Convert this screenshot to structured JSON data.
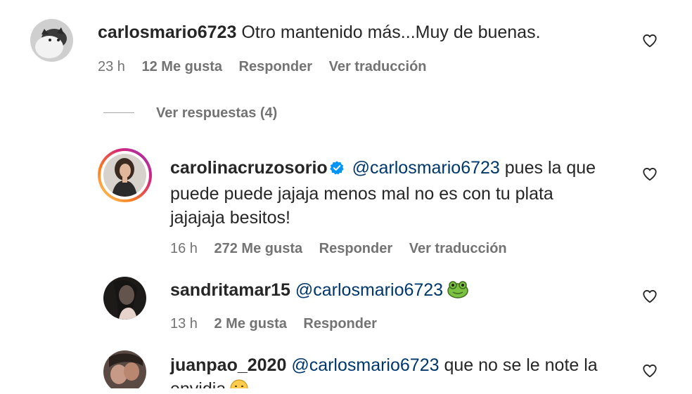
{
  "comments": [
    {
      "username": "carlosmario6723",
      "text": "Otro mantenido más...Muy de buenas.",
      "time": "23 h",
      "likes": "12 Me gusta",
      "reply": "Responder",
      "translate": "Ver traducción"
    },
    {
      "username": "carolinacruzosorio",
      "mention": "@carlosmario6723",
      "line1": "pues la que",
      "line2": "puede puede jajaja menos mal no es con tu plata",
      "line3": "jajajaja besitos!",
      "time": "16 h",
      "likes": "272 Me gusta",
      "reply": "Responder",
      "translate": "Ver traducción"
    },
    {
      "username": "sandritamar15",
      "mention": "@carlosmario6723",
      "emoji": "frog-emoji",
      "time": "13 h",
      "likes": "2 Me gusta",
      "reply": "Responder"
    },
    {
      "username": "juanpao_2020",
      "mention": "@carlosmario6723",
      "line1": "que no se le note la",
      "line2": "envidia",
      "emoji": "smirk-emoji"
    }
  ],
  "replies_toggle": "Ver respuestas (4)",
  "icons": {
    "like": "heart-outline-icon",
    "verified": "verified-badge-icon"
  },
  "colors": {
    "mention": "#00376b",
    "verified": "#0095f6",
    "meta": "#737373",
    "text": "#262626"
  }
}
